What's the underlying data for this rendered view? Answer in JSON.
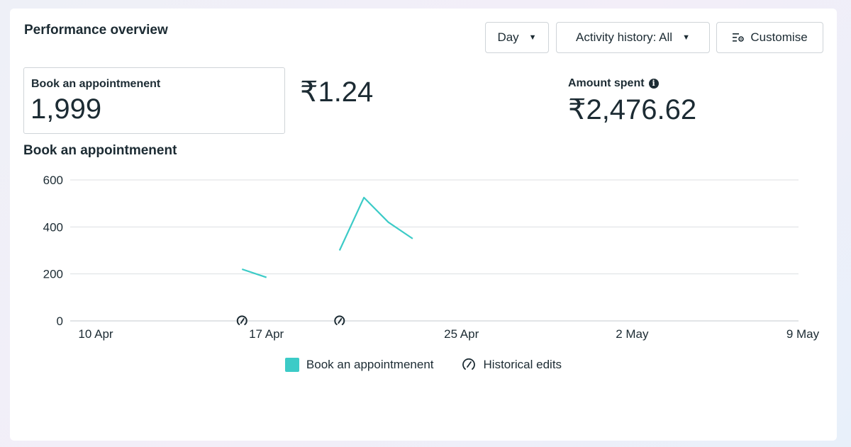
{
  "header": {
    "title": "Performance overview",
    "day_label": "Day",
    "activity_label": "Activity history: All",
    "customise_label": "Customise"
  },
  "metrics": {
    "result_label": "Book an appointmenent",
    "result_value": "1,999",
    "cost_per_result": "₹1.24",
    "spent_label": "Amount spent",
    "spent_value": "₹2,476.62"
  },
  "colors": {
    "series": "#3ccbc7",
    "grid": "#dcdfe2",
    "text": "#1c2b33"
  },
  "icons": {
    "dropdown": "caret-down-icon",
    "customise": "settings-sliders-icon",
    "info": "info-icon",
    "historical_edit": "historical-edit-icon"
  },
  "chart_data": {
    "type": "line",
    "title": "Book an appointmenent",
    "y_ticks": [
      0,
      200,
      400,
      600
    ],
    "ylim": [
      0,
      600
    ],
    "x_ticks": [
      {
        "date": "2024-04-10",
        "label": "10 Apr"
      },
      {
        "date": "2024-04-17",
        "label": "17 Apr"
      },
      {
        "date": "2024-04-25",
        "label": "25 Apr"
      },
      {
        "date": "2024-05-02",
        "label": "2 May"
      },
      {
        "date": "2024-05-09",
        "label": "9 May"
      }
    ],
    "series": [
      {
        "name": "Book an appointmenent",
        "segments": [
          [
            {
              "x": "2024-04-16",
              "y": 220
            },
            {
              "x": "2024-04-17",
              "y": 185
            }
          ],
          [
            {
              "x": "2024-04-20",
              "y": 300
            },
            {
              "x": "2024-04-21",
              "y": 525
            },
            {
              "x": "2024-04-22",
              "y": 420
            },
            {
              "x": "2024-04-23",
              "y": 350
            }
          ]
        ]
      }
    ],
    "historical_edits": [
      "2024-04-16",
      "2024-04-20"
    ],
    "legend": [
      {
        "label": "Book an appointmenent",
        "kind": "series"
      },
      {
        "label": "Historical edits",
        "kind": "edit"
      }
    ],
    "grid": true,
    "legend_position": "bottom"
  }
}
